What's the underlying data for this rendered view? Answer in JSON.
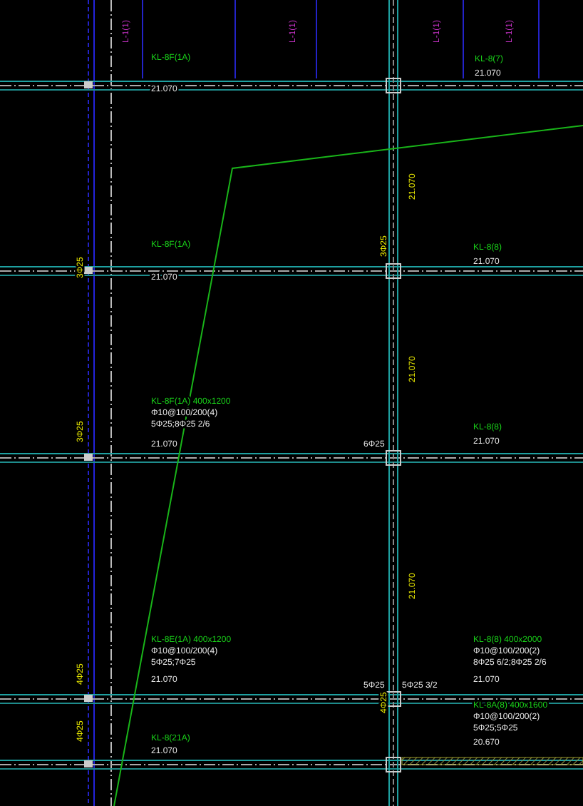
{
  "drawing": {
    "annotations": [
      {
        "kind": "beam",
        "text": "KL-8F(1A)"
      },
      {
        "kind": "beam",
        "text": "KL-8(7)"
      },
      {
        "kind": "note",
        "text": "21.070"
      },
      {
        "kind": "note",
        "text": "21.070"
      },
      {
        "kind": "beam",
        "text": "KL-8F(1A)"
      },
      {
        "kind": "note",
        "text": "21.070"
      },
      {
        "kind": "beam",
        "text": "KL-8(8)"
      },
      {
        "kind": "note",
        "text": "21.070"
      },
      {
        "kind": "beam",
        "text": "KL-8F(1A) 400x1200"
      },
      {
        "kind": "note",
        "text": "Φ10@100/200(4)"
      },
      {
        "kind": "note",
        "text": "5Φ25;8Φ25 2/6"
      },
      {
        "kind": "note",
        "text": "21.070"
      },
      {
        "kind": "beam",
        "text": "KL-8(8)"
      },
      {
        "kind": "note",
        "text": "21.070"
      },
      {
        "kind": "note",
        "text": "6Φ25"
      },
      {
        "kind": "beam",
        "text": "KL-8E(1A) 400x1200"
      },
      {
        "kind": "note",
        "text": "Φ10@100/200(4)"
      },
      {
        "kind": "note",
        "text": "5Φ25;7Φ25"
      },
      {
        "kind": "note",
        "text": "21.070"
      },
      {
        "kind": "beam",
        "text": "KL-8(8) 400x2000"
      },
      {
        "kind": "note",
        "text": "Φ10@100/200(2)"
      },
      {
        "kind": "note",
        "text": "8Φ25 6/2;8Φ25 2/6"
      },
      {
        "kind": "note",
        "text": "21.070"
      },
      {
        "kind": "note",
        "text": "5Φ25"
      },
      {
        "kind": "note",
        "text": "5Φ25 3/2"
      },
      {
        "kind": "beam",
        "text": "KL-8A(8) 400x1600"
      },
      {
        "kind": "note",
        "text": "Φ10@100/200(2)"
      },
      {
        "kind": "note",
        "text": "5Φ25;5Φ25"
      },
      {
        "kind": "note",
        "text": "20.670"
      },
      {
        "kind": "beam",
        "text": "KL-8(21A)"
      },
      {
        "kind": "note",
        "text": "21.070"
      },
      {
        "kind": "mark",
        "text": "21.070"
      },
      {
        "kind": "mark",
        "text": "21.070"
      },
      {
        "kind": "mark",
        "text": "21.070"
      },
      {
        "kind": "mark",
        "text": "3Φ25"
      },
      {
        "kind": "mark",
        "text": "3Φ25"
      },
      {
        "kind": "mark",
        "text": "3Φ25"
      },
      {
        "kind": "mark",
        "text": "4Φ25"
      },
      {
        "kind": "mark",
        "text": "4Φ25"
      },
      {
        "kind": "mark",
        "text": "4Φ25"
      },
      {
        "kind": "secondary",
        "text": "L-1(1)"
      },
      {
        "kind": "secondary",
        "text": "L-1(1)"
      },
      {
        "kind": "secondary",
        "text": "L-1(1)"
      },
      {
        "kind": "secondary",
        "text": "L-1(1)"
      }
    ]
  }
}
